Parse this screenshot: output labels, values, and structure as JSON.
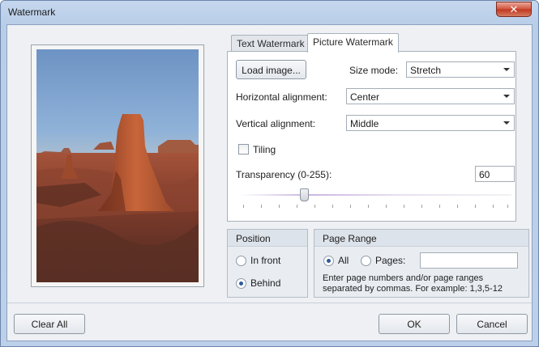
{
  "window": {
    "title": "Watermark",
    "close_symbol": "✕"
  },
  "tabs": [
    {
      "label": "Text Watermark",
      "active": false
    },
    {
      "label": "Picture Watermark",
      "active": true
    }
  ],
  "picture": {
    "load_button": "Load image...",
    "size_mode_label": "Size mode:",
    "size_mode_value": "Stretch",
    "horizontal_label": "Horizontal alignment:",
    "horizontal_value": "Center",
    "vertical_label": "Vertical alignment:",
    "vertical_value": "Middle",
    "tiling_label": "Tiling",
    "tiling_checked": false,
    "transparency_label": "Transparency (0-255):",
    "transparency_value": "60",
    "transparency_max": 255
  },
  "position": {
    "title": "Position",
    "options": [
      {
        "label": "In front",
        "selected": false
      },
      {
        "label": "Behind",
        "selected": true
      }
    ]
  },
  "page_range": {
    "title": "Page Range",
    "all_label": "All",
    "all_selected": true,
    "pages_label": "Pages:",
    "pages_value": "",
    "hint_line1": "Enter page numbers and/or page ranges",
    "hint_line2": "separated by commas. For example: 1,3,5-12"
  },
  "buttons": {
    "clear_all": "Clear All",
    "ok": "OK",
    "cancel": "Cancel"
  },
  "colors": {
    "title_bar": "#bdd0ea",
    "close_button": "#c9442b",
    "accent": "#2e5a98"
  }
}
